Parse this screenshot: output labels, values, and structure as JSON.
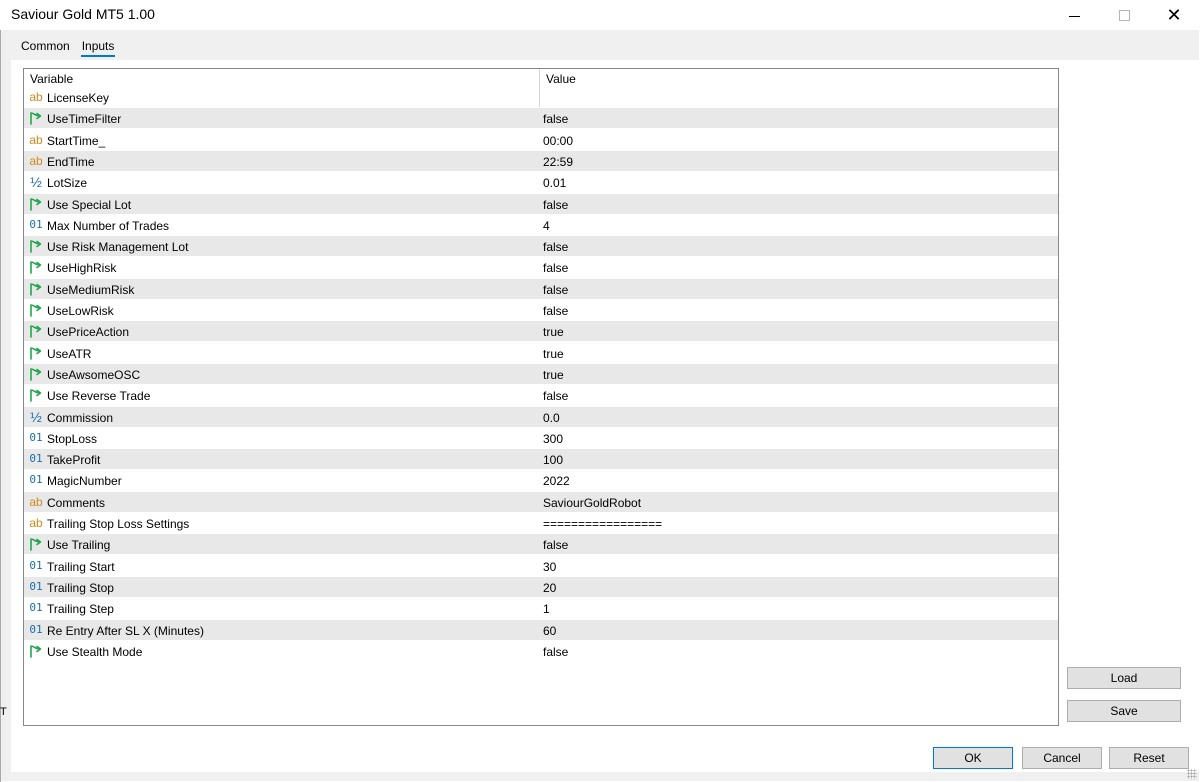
{
  "window": {
    "title": "Saviour Gold MT5 1.00"
  },
  "tabs": [
    {
      "label": "Common",
      "active": false
    },
    {
      "label": "Inputs",
      "active": true
    }
  ],
  "grid": {
    "headers": {
      "variable": "Variable",
      "value": "Value"
    },
    "rows": [
      {
        "type_icon": "ab",
        "name": "LicenseKey",
        "value": ""
      },
      {
        "type_icon": "bool",
        "name": "UseTimeFilter",
        "value": "false"
      },
      {
        "type_icon": "ab",
        "name": "StartTime_",
        "value": "00:00"
      },
      {
        "type_icon": "ab",
        "name": "EndTime",
        "value": "22:59"
      },
      {
        "type_icon": "half",
        "name": "LotSize",
        "value": "0.01"
      },
      {
        "type_icon": "bool",
        "name": "Use Special Lot",
        "value": "false"
      },
      {
        "type_icon": "01",
        "name": "Max Number of Trades",
        "value": "4"
      },
      {
        "type_icon": "bool",
        "name": "Use Risk Management Lot",
        "value": "false"
      },
      {
        "type_icon": "bool",
        "name": "UseHighRisk",
        "value": "false"
      },
      {
        "type_icon": "bool",
        "name": "UseMediumRisk",
        "value": "false"
      },
      {
        "type_icon": "bool",
        "name": "UseLowRisk",
        "value": "false"
      },
      {
        "type_icon": "bool",
        "name": "UsePriceAction",
        "value": "true"
      },
      {
        "type_icon": "bool",
        "name": "UseATR",
        "value": "true"
      },
      {
        "type_icon": "bool",
        "name": "UseAwsomeOSC",
        "value": "true"
      },
      {
        "type_icon": "bool",
        "name": "Use Reverse Trade",
        "value": "false"
      },
      {
        "type_icon": "half",
        "name": "Commission",
        "value": "0.0"
      },
      {
        "type_icon": "01",
        "name": "StopLoss",
        "value": "300"
      },
      {
        "type_icon": "01",
        "name": "TakeProfit",
        "value": "100"
      },
      {
        "type_icon": "01",
        "name": "MagicNumber",
        "value": "2022"
      },
      {
        "type_icon": "ab",
        "name": "Comments",
        "value": "SaviourGoldRobot"
      },
      {
        "type_icon": "ab",
        "name": "Trailing Stop Loss Settings",
        "value": "================="
      },
      {
        "type_icon": "bool",
        "name": "Use Trailing",
        "value": "false"
      },
      {
        "type_icon": "01",
        "name": "Trailing Start",
        "value": "30"
      },
      {
        "type_icon": "01",
        "name": "Trailing Stop",
        "value": "20"
      },
      {
        "type_icon": "01",
        "name": "Trailing Step",
        "value": "1"
      },
      {
        "type_icon": "01",
        "name": "Re Entry After SL X (Minutes)",
        "value": "60"
      },
      {
        "type_icon": "bool",
        "name": "Use Stealth Mode",
        "value": "false"
      }
    ]
  },
  "icon_glyphs": {
    "ab": "ab",
    "01": "01",
    "half": "½"
  },
  "buttons": {
    "load": "Load",
    "save": "Save",
    "ok": "OK",
    "cancel": "Cancel",
    "reset": "Reset"
  },
  "left_edge_glyph": "T",
  "colors": {
    "string_icon": "#d28a1e",
    "number_icon": "#1b6ea8",
    "bool_icon": "#1ea84b",
    "alt_row": "#e8e8e8",
    "ok_border": "#0078d7"
  }
}
